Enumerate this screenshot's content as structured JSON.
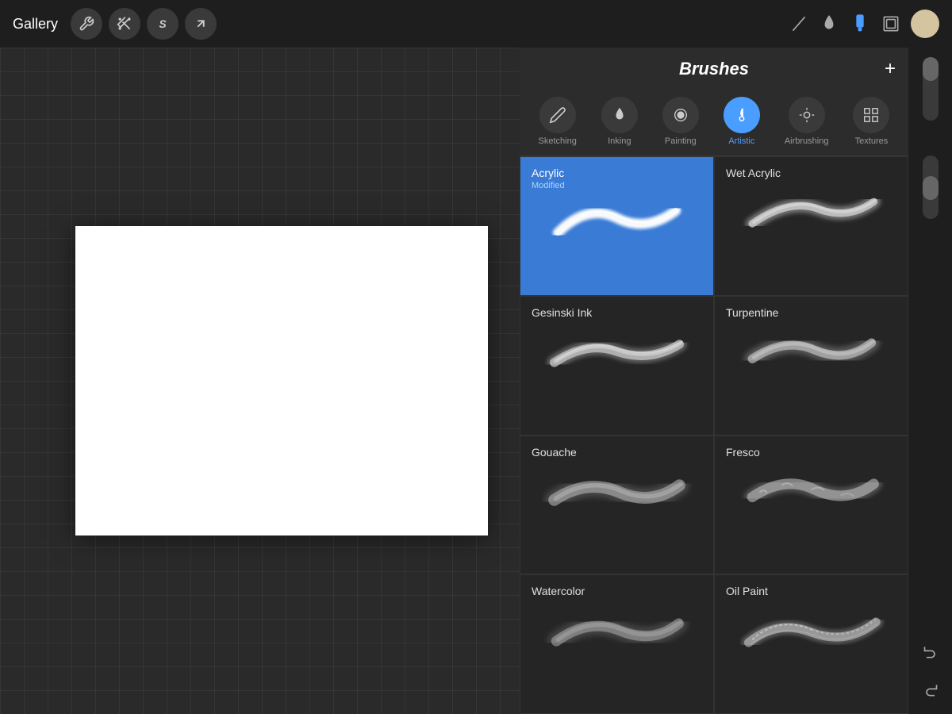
{
  "toolbar": {
    "gallery_label": "Gallery",
    "tools": [
      {
        "name": "wrench",
        "icon": "⚙",
        "active": false
      },
      {
        "name": "magic-wand",
        "icon": "✦",
        "active": false
      },
      {
        "name": "undo-history",
        "icon": "S",
        "active": false
      },
      {
        "name": "transform",
        "icon": "↗",
        "active": false
      }
    ],
    "right_tools": [
      {
        "name": "pen-tool",
        "icon": "pen",
        "active": false
      },
      {
        "name": "ink-tool",
        "icon": "ink",
        "active": false
      },
      {
        "name": "brush-tool",
        "icon": "brush",
        "active": true
      },
      {
        "name": "layers-tool",
        "icon": "layers",
        "active": false
      }
    ]
  },
  "brushes_panel": {
    "title": "Brushes",
    "add_button": "+",
    "categories": [
      {
        "id": "sketching",
        "label": "Sketching",
        "icon": "✏",
        "active": false
      },
      {
        "id": "inking",
        "label": "Inking",
        "icon": "💧",
        "active": false
      },
      {
        "id": "painting",
        "label": "Painting",
        "icon": "◉",
        "active": false
      },
      {
        "id": "artistic",
        "label": "Artistic",
        "icon": "🎨",
        "active": true
      },
      {
        "id": "airbrushing",
        "label": "Airbrushing",
        "icon": "🌀",
        "active": false
      },
      {
        "id": "textures",
        "label": "Textures",
        "icon": "⊞",
        "active": false
      }
    ],
    "brushes": [
      {
        "id": "acrylic",
        "name": "Acrylic",
        "sub": "Modified",
        "selected": true,
        "col": 0
      },
      {
        "id": "wet-acrylic",
        "name": "Wet Acrylic",
        "sub": "",
        "selected": false,
        "col": 1
      },
      {
        "id": "gesinski-ink",
        "name": "Gesinski Ink",
        "sub": "",
        "selected": false,
        "col": 0
      },
      {
        "id": "turpentine",
        "name": "Turpentine",
        "sub": "",
        "selected": false,
        "col": 1
      },
      {
        "id": "gouache",
        "name": "Gouache",
        "sub": "",
        "selected": false,
        "col": 0
      },
      {
        "id": "fresco",
        "name": "Fresco",
        "sub": "",
        "selected": false,
        "col": 1
      },
      {
        "id": "watercolor",
        "name": "Watercolor",
        "sub": "",
        "selected": false,
        "col": 0
      },
      {
        "id": "oil-paint",
        "name": "Oil Paint",
        "sub": "",
        "selected": false,
        "col": 1
      }
    ]
  }
}
